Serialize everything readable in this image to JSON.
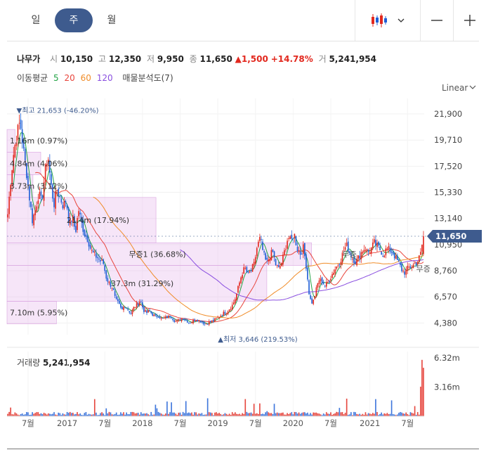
{
  "tabs": {
    "day": "일",
    "week": "주",
    "month": "월"
  },
  "toolbar": {
    "chart_type_icon": "candlestick-icon",
    "dropdown_icon": "chevron-down-icon",
    "zoom_out_icon": "minus-icon",
    "zoom_in_icon": "plus-icon"
  },
  "stock": {
    "name": "나무가",
    "open_label": "시",
    "open": "10,150",
    "high_label": "고",
    "high": "12,350",
    "low_label": "저",
    "low": "9,950",
    "close_label": "종",
    "close": "11,650",
    "change": "▲1,500",
    "change_pct": "+14.78%",
    "volume_label": "거",
    "volume": "5,241,954"
  },
  "moving_average": {
    "label": "이동평균",
    "periods": [
      {
        "value": "5",
        "color": "#22a344"
      },
      {
        "value": "20",
        "color": "#e8453c"
      },
      {
        "value": "60",
        "color": "#f08c28"
      },
      {
        "value": "120",
        "color": "#8a4fe0"
      }
    ],
    "volume_profile_label": "매물분석도(7)"
  },
  "scale_mode": "Linear",
  "volume_title": "거래량",
  "volume_value": "5,241,954",
  "colors": {
    "up": "#e2281e",
    "down": "#1f5fd6",
    "profile_fill": "rgba(228,180,235,0.35)",
    "profile_stroke": "#d9a4e0",
    "current_badge": "#3e5b8e"
  },
  "chart_data": {
    "type": "candlestick",
    "price_axis": {
      "ticks": [
        21900,
        19710,
        17520,
        15330,
        13140,
        10950,
        8760,
        6570,
        4380
      ],
      "tick_labels": [
        "21,900",
        "19,710",
        "17,520",
        "15,330",
        "13,140",
        "10,950",
        "8,760",
        "6,570",
        "4,380"
      ],
      "ylim": [
        3400,
        23200
      ]
    },
    "volume_axis": {
      "tick_labels": [
        "6.32m",
        "3.16m"
      ],
      "ticks": [
        6320000,
        3160000
      ],
      "ylim": [
        0,
        7000000
      ]
    },
    "x_labels": [
      "7월",
      "2017",
      "7월",
      "2018",
      "7월",
      "2019",
      "7월",
      "2020",
      "7월",
      "2021",
      "7월"
    ],
    "x_label_weeks": [
      14,
      41,
      67,
      93,
      119,
      145,
      171,
      197,
      223,
      250,
      276
    ],
    "total_weeks": 288,
    "high_marker": {
      "text": "▼최고 21,653 (-46.20%)",
      "week": 8,
      "price": 21653
    },
    "low_marker": {
      "text": "▲최저 3,646 (219.53%)",
      "week": 148,
      "price": 3646
    },
    "current_price": {
      "label": "11,650",
      "price": 11650
    },
    "price_anchors": [
      [
        0,
        13500
      ],
      [
        2,
        16500
      ],
      [
        4,
        18800
      ],
      [
        6,
        20200
      ],
      [
        8,
        21300
      ],
      [
        10,
        19000
      ],
      [
        12,
        17200
      ],
      [
        14,
        15000
      ],
      [
        16,
        13000
      ],
      [
        18,
        13900
      ],
      [
        20,
        15200
      ],
      [
        22,
        14500
      ],
      [
        24,
        16800
      ],
      [
        26,
        18600
      ],
      [
        28,
        16000
      ],
      [
        30,
        14300
      ],
      [
        32,
        15600
      ],
      [
        34,
        14900
      ],
      [
        36,
        14200
      ],
      [
        38,
        14700
      ],
      [
        40,
        12600
      ],
      [
        42,
        13300
      ],
      [
        44,
        12000
      ],
      [
        46,
        13900
      ],
      [
        48,
        12700
      ],
      [
        50,
        11800
      ],
      [
        52,
        11400
      ],
      [
        54,
        10500
      ],
      [
        56,
        10100
      ],
      [
        58,
        9900
      ],
      [
        60,
        9600
      ],
      [
        62,
        9400
      ],
      [
        64,
        8200
      ],
      [
        66,
        7700
      ],
      [
        68,
        7400
      ],
      [
        70,
        6300
      ],
      [
        72,
        6000
      ],
      [
        74,
        5400
      ],
      [
        76,
        5900
      ],
      [
        78,
        5500
      ],
      [
        80,
        5200
      ],
      [
        82,
        5700
      ],
      [
        84,
        5900
      ],
      [
        86,
        6300
      ],
      [
        88,
        5500
      ],
      [
        90,
        5200
      ],
      [
        92,
        5400
      ],
      [
        94,
        5100
      ],
      [
        96,
        4900
      ],
      [
        98,
        5000
      ],
      [
        100,
        4700
      ],
      [
        102,
        4800
      ],
      [
        104,
        4900
      ],
      [
        106,
        5000
      ],
      [
        108,
        4600
      ],
      [
        110,
        4500
      ],
      [
        112,
        4700
      ],
      [
        114,
        4800
      ],
      [
        116,
        4600
      ],
      [
        118,
        4400
      ],
      [
        120,
        4500
      ],
      [
        122,
        4700
      ],
      [
        124,
        4600
      ],
      [
        126,
        4500
      ],
      [
        128,
        4300
      ],
      [
        130,
        4400
      ],
      [
        132,
        4500
      ],
      [
        134,
        4600
      ],
      [
        136,
        4800
      ],
      [
        138,
        5000
      ],
      [
        140,
        5200
      ],
      [
        142,
        5300
      ],
      [
        144,
        5600
      ],
      [
        146,
        5900
      ],
      [
        148,
        6500
      ],
      [
        150,
        7500
      ],
      [
        152,
        8500
      ],
      [
        154,
        9000
      ],
      [
        156,
        8400
      ],
      [
        158,
        8800
      ],
      [
        160,
        9300
      ],
      [
        162,
        10800
      ],
      [
        164,
        11500
      ],
      [
        166,
        10200
      ],
      [
        168,
        9400
      ],
      [
        170,
        9900
      ],
      [
        172,
        10400
      ],
      [
        174,
        9300
      ],
      [
        176,
        8900
      ],
      [
        178,
        9500
      ],
      [
        180,
        10500
      ],
      [
        182,
        11600
      ],
      [
        184,
        11200
      ],
      [
        186,
        11900
      ],
      [
        188,
        10600
      ],
      [
        190,
        10200
      ],
      [
        192,
        10700
      ],
      [
        194,
        9000
      ],
      [
        196,
        6500
      ],
      [
        198,
        6000
      ],
      [
        200,
        7000
      ],
      [
        202,
        8000
      ],
      [
        204,
        7900
      ],
      [
        206,
        7500
      ],
      [
        208,
        7800
      ],
      [
        210,
        8300
      ],
      [
        212,
        8800
      ],
      [
        214,
        9200
      ],
      [
        216,
        9600
      ],
      [
        218,
        10400
      ],
      [
        220,
        10900
      ],
      [
        222,
        10300
      ],
      [
        224,
        9800
      ],
      [
        226,
        9500
      ],
      [
        228,
        9900
      ],
      [
        230,
        10400
      ],
      [
        232,
        10700
      ],
      [
        234,
        10300
      ],
      [
        236,
        10600
      ],
      [
        238,
        11100
      ],
      [
        240,
        10800
      ],
      [
        242,
        10500
      ],
      [
        244,
        10100
      ],
      [
        246,
        10600
      ],
      [
        248,
        10500
      ],
      [
        250,
        10300
      ],
      [
        252,
        9800
      ],
      [
        254,
        9400
      ],
      [
        256,
        8800
      ],
      [
        258,
        8600
      ],
      [
        260,
        9000
      ],
      [
        262,
        9100
      ],
      [
        264,
        9300
      ],
      [
        266,
        9500
      ],
      [
        268,
        10100
      ],
      [
        270,
        11650
      ]
    ],
    "series": [
      {
        "name": "5",
        "color": "#22a344"
      },
      {
        "name": "20",
        "color": "#e8453c"
      },
      {
        "name": "60",
        "color": "#f08c28"
      },
      {
        "name": "120",
        "color": "#8a4fe0"
      }
    ],
    "volume_profile": [
      {
        "low": 18700,
        "high": 20600,
        "label": "1.16m (0.97%)",
        "pct": 0.97
      },
      {
        "low": 16800,
        "high": 18700,
        "label": "4.84m (4.06%)",
        "pct": 4.06
      },
      {
        "low": 14900,
        "high": 16800,
        "label": "3.73m (3.12%)",
        "pct": 3.12
      },
      {
        "low": 11100,
        "high": 14900,
        "label": "21.4m (17.94%)",
        "pct": 17.94
      },
      {
        "low": 9200,
        "high": 11100,
        "label": "무증1 (36.68%)",
        "pct": 36.68
      },
      {
        "low": 6200,
        "high": 9200,
        "label": "37.3m (31.29%)",
        "pct": 31.29
      },
      {
        "low": 4300,
        "high": 6200,
        "label": "7.10m (5.95%)",
        "pct": 5.95
      }
    ],
    "event_labels": [
      {
        "text": "무증",
        "week": 231,
        "price": 9900
      },
      {
        "text": "무증",
        "week": 282,
        "price": 8700
      }
    ]
  }
}
